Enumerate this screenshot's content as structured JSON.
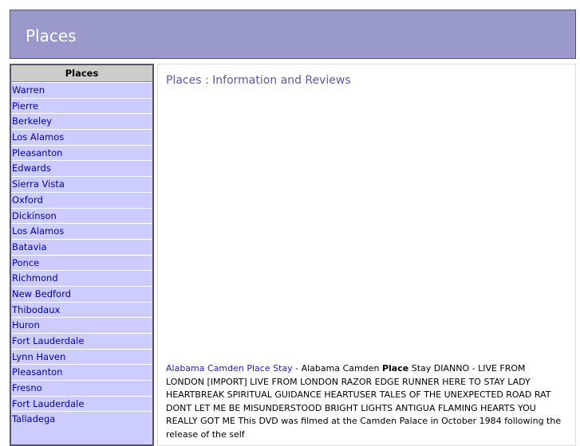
{
  "header": {
    "title": "Places"
  },
  "sidebar": {
    "heading": "Places",
    "items": [
      "Warren",
      "Pierre",
      "Berkeley",
      "Los Alamos",
      "Pleasanton",
      "Edwards",
      "Sierra Vista",
      "Oxford",
      "Dickinson",
      "Los Alamos",
      "Batavia",
      "Ponce",
      "Richmond",
      "New Bedford",
      "Thibodaux",
      "Huron",
      "Fort Lauderdale",
      "Lynn Haven",
      "Pleasanton",
      "Fresno",
      "Fort Lauderdale",
      "Talladega"
    ]
  },
  "main": {
    "title": "Places : Information and Reviews",
    "result": {
      "link": "Alabama Camden Place Stay",
      "pre": " - Alabama Camden ",
      "bold": "Place",
      "post": " Stay DIANNO - LIVE FROM LONDON [IMPORT] LIVE FROM LONDON RAZOR EDGE RUNNER HERE TO STAY LADY HEARTBREAK SPIRITUAL GUIDANCE HEARTUSER TALES OF THE UNEXPECTED ROAD RAT DONT LET ME BE MISUNDERSTOOD BRIGHT LIGHTS ANTIGUA FLAMING HEARTS YOU REALLY GOT ME This DVD was filmed at the Camden Palace in October 1984 following the release of the self"
    }
  },
  "colors": {
    "header_bg": "#9999cc",
    "sidebar_bg": "#ccccff",
    "sidebar_heading_bg": "#cccccc",
    "link": "#0000aa",
    "title": "#5a5aa8"
  }
}
